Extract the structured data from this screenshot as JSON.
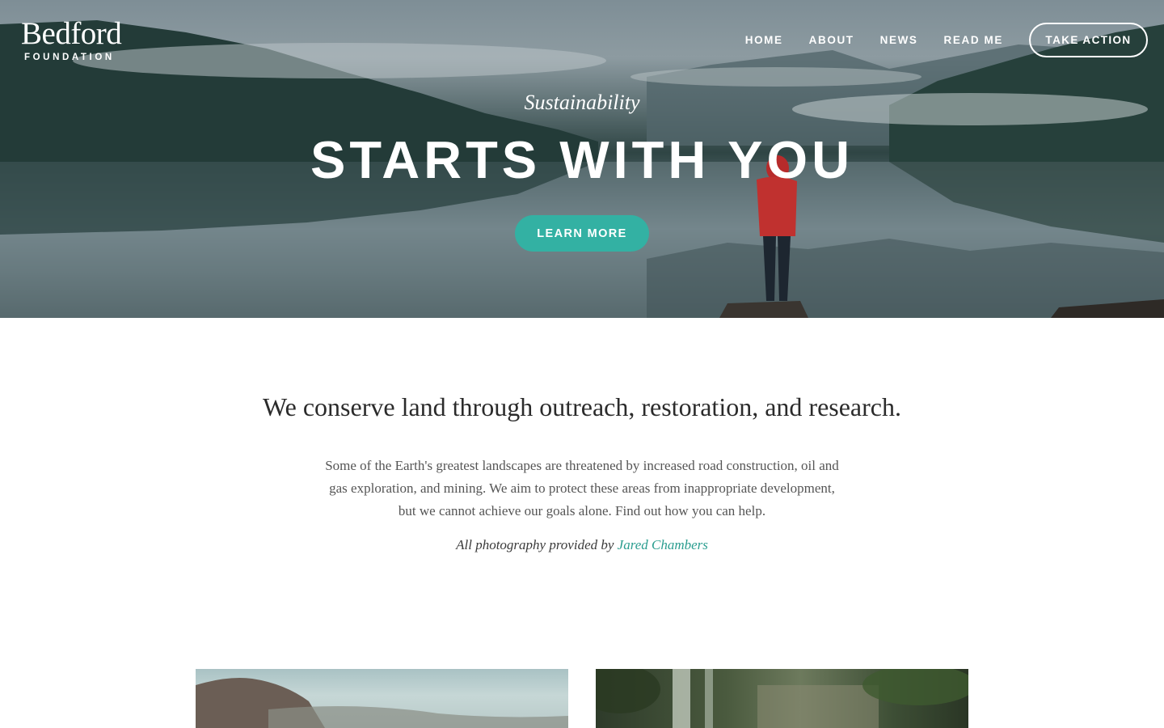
{
  "brand": {
    "name": "Bedford",
    "subtitle": "FOUNDATION"
  },
  "nav": {
    "links": [
      "HOME",
      "ABOUT",
      "NEWS",
      "READ ME"
    ],
    "cta": "TAKE ACTION"
  },
  "hero": {
    "eyebrow": "Sustainability",
    "title": "STARTS WITH YOU",
    "button": "LEARN MORE"
  },
  "intro": {
    "heading": "We conserve land through outreach, restoration, and research.",
    "body": "Some of the Earth's greatest landscapes are threatened by increased road construction, oil and gas exploration, and mining. We aim to protect these areas from inappropriate development, but we cannot achieve our goals alone. Find out how you can help.",
    "credit_prefix": "All photography provided by",
    "credit_name": "Jared Chambers"
  },
  "colors": {
    "accent": "#33b1a3",
    "link": "#2a9d8f",
    "heading_text": "#2b2b2b",
    "body_text": "#555555"
  },
  "icons": {
    "hero_image": "misty-lake-photo",
    "card_left_image": "mountain-valley-photo",
    "card_right_image": "forest-waterfall-photo"
  }
}
